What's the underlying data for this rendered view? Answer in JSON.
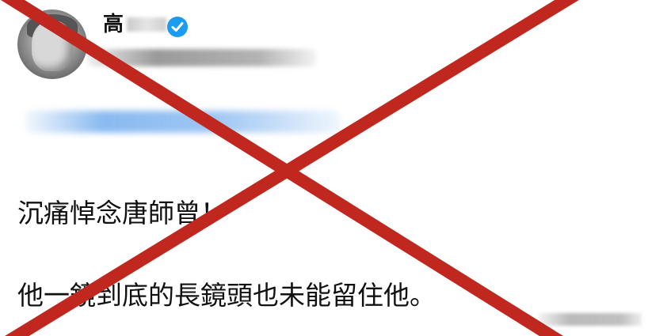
{
  "post": {
    "author": {
      "name": "高",
      "verified_icon": "verified-check-icon"
    },
    "text_line_1": "沉痛悼念唐師曾！",
    "text_line_2": "他一鏡到底的長鏡頭也未能留住他。"
  },
  "overlay": {
    "icon": "red-cross-icon",
    "color": "#c0271f"
  }
}
